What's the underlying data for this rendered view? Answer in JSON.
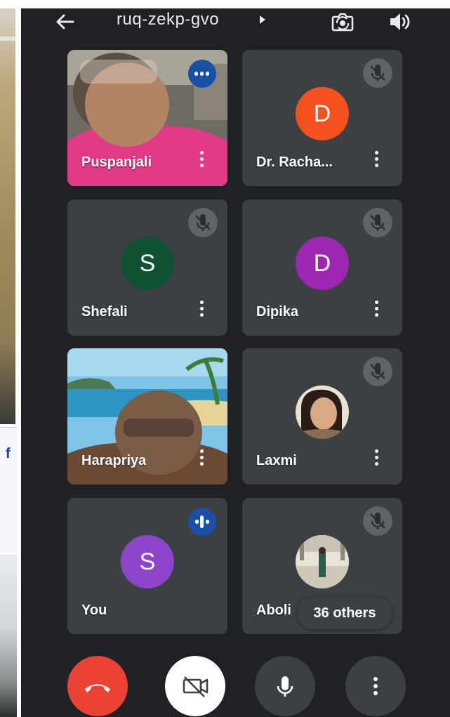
{
  "meeting": {
    "code": "ruq-zekp-gvo"
  },
  "icons": {
    "back": "arrow-left-icon",
    "switch_camera": "switch-camera-icon",
    "audio_output": "speaker-icon",
    "muted": "mic-off-icon",
    "speaking": "audio-level-icon",
    "more": "more-vertical-icon",
    "hang_up": "phone-hangup-icon",
    "camera_off": "videocam-off-icon",
    "mic": "mic-icon"
  },
  "left_strip": {
    "partial_text": "f"
  },
  "participants": [
    {
      "name": "Puspanjali",
      "type": "video",
      "speaking": true
    },
    {
      "name": "Dr. Racha...",
      "type": "avatar",
      "initial": "D",
      "color": "#f4511e",
      "muted": true
    },
    {
      "name": "Shefali",
      "type": "avatar",
      "initial": "S",
      "color": "#0f5132",
      "muted": true
    },
    {
      "name": "Dipika",
      "type": "avatar",
      "initial": "D",
      "color": "#9c27b0",
      "muted": true
    },
    {
      "name": "Harapriya",
      "type": "video"
    },
    {
      "name": "Laxmi",
      "type": "photo",
      "muted": true
    },
    {
      "name": "You",
      "type": "avatar",
      "initial": "S",
      "color": "#8e44c9",
      "speaking": true
    },
    {
      "name": "Aboli",
      "type": "photo",
      "muted": true
    }
  ],
  "others": {
    "label": "36 others"
  },
  "controls": {
    "hang_up_color": "#ea4335",
    "camera_bg": "#ffffff",
    "button_bg": "#3c4043"
  }
}
